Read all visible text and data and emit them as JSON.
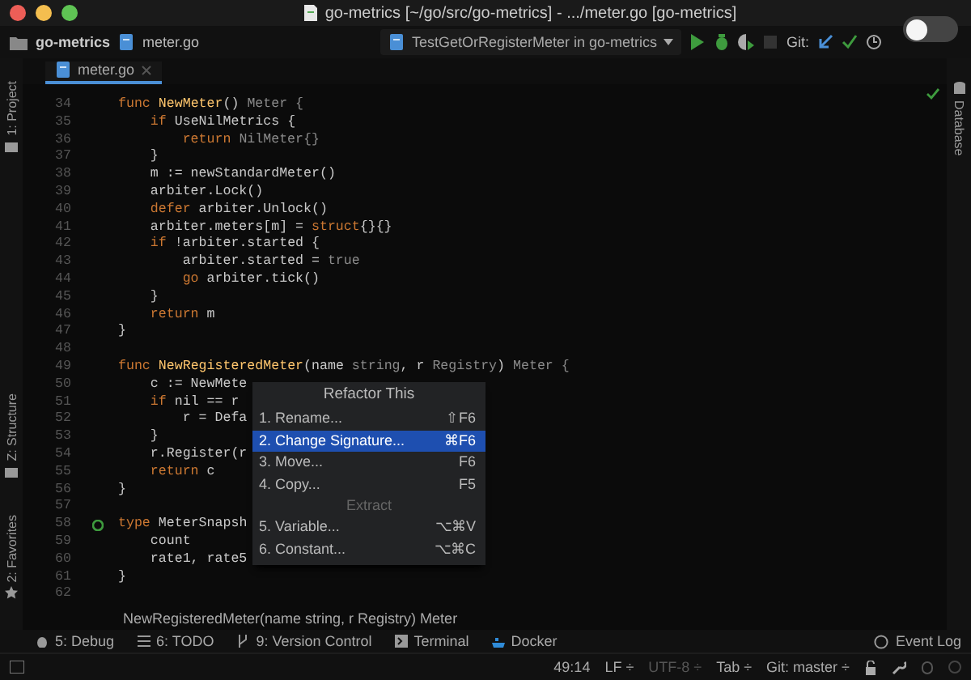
{
  "window": {
    "title": "go-metrics [~/go/src/go-metrics] - .../meter.go [go-metrics]"
  },
  "navbar": {
    "project": "go-metrics",
    "file": "meter.go",
    "run_config": "TestGetOrRegisterMeter in go-metrics",
    "git_label": "Git:"
  },
  "toggle": {
    "on": false
  },
  "tabs": [
    {
      "label": "meter.go",
      "selected": true
    }
  ],
  "left_tools": [
    "1: Project",
    "Z: Structure",
    "2: Favorites"
  ],
  "right_tools": [
    "Database"
  ],
  "editor": {
    "lines": [
      {
        "number": "34",
        "tokens": [
          {
            "text": "func ",
            "kind": "kw"
          },
          {
            "text": "NewMeter",
            "kind": "fn"
          },
          {
            "text": "() ",
            "kind": "txt"
          },
          {
            "text": "Meter {",
            "kind": "dim"
          }
        ]
      },
      {
        "number": "35",
        "tokens": [
          {
            "text": "    if ",
            "kind": "kw"
          },
          {
            "text": "UseNilMetrics {",
            "kind": "txt"
          }
        ]
      },
      {
        "number": "36",
        "tokens": [
          {
            "text": "        return ",
            "kind": "kw"
          },
          {
            "text": "NilMeter{}",
            "kind": "dim"
          }
        ]
      },
      {
        "number": "37",
        "tokens": [
          {
            "text": "    }",
            "kind": "txt"
          }
        ]
      },
      {
        "number": "38",
        "tokens": [
          {
            "text": "    m := newStandardMeter()",
            "kind": "txt"
          }
        ]
      },
      {
        "number": "39",
        "tokens": [
          {
            "text": "    arbiter.Lock()",
            "kind": "txt"
          }
        ]
      },
      {
        "number": "40",
        "tokens": [
          {
            "text": "    defer ",
            "kind": "kw"
          },
          {
            "text": "arbiter.Unlock()",
            "kind": "txt"
          }
        ]
      },
      {
        "number": "41",
        "tokens": [
          {
            "text": "    arbiter.meters[m] = ",
            "kind": "txt"
          },
          {
            "text": "struct",
            "kind": "kw"
          },
          {
            "text": "{}{}",
            "kind": "txt"
          }
        ]
      },
      {
        "number": "42",
        "tokens": [
          {
            "text": "    if ",
            "kind": "kw"
          },
          {
            "text": "!arbiter.started {",
            "kind": "txt"
          }
        ]
      },
      {
        "number": "43",
        "tokens": [
          {
            "text": "        arbiter.started = ",
            "kind": "txt"
          },
          {
            "text": "true",
            "kind": "dim"
          }
        ]
      },
      {
        "number": "44",
        "tokens": [
          {
            "text": "        go ",
            "kind": "kw"
          },
          {
            "text": "arbiter.tick()",
            "kind": "txt"
          }
        ]
      },
      {
        "number": "45",
        "tokens": [
          {
            "text": "    }",
            "kind": "txt"
          }
        ]
      },
      {
        "number": "46",
        "tokens": [
          {
            "text": "    return ",
            "kind": "kw"
          },
          {
            "text": "m",
            "kind": "txt"
          }
        ]
      },
      {
        "number": "47",
        "tokens": [
          {
            "text": "}",
            "kind": "txt"
          }
        ]
      },
      {
        "number": "48"
      },
      {
        "number": "49",
        "tokens": [
          {
            "text": "func ",
            "kind": "kw"
          },
          {
            "text": "NewRegisteredMeter",
            "kind": "fn"
          },
          {
            "text": "(name ",
            "kind": "txt"
          },
          {
            "text": "string",
            "kind": "dim"
          },
          {
            "text": ", r ",
            "kind": "txt"
          },
          {
            "text": "Registry",
            "kind": "dim"
          },
          {
            "text": ") ",
            "kind": "txt"
          },
          {
            "text": "Meter {",
            "kind": "dim"
          }
        ]
      },
      {
        "number": "50",
        "tokens": [
          {
            "text": "    c := NewMete",
            "kind": "txt"
          }
        ]
      },
      {
        "number": "51",
        "tokens": [
          {
            "text": "    if ",
            "kind": "kw"
          },
          {
            "text": "nil == r",
            "kind": "txt"
          }
        ]
      },
      {
        "number": "52",
        "tokens": [
          {
            "text": "        r = Defa",
            "kind": "txt"
          }
        ]
      },
      {
        "number": "53",
        "tokens": [
          {
            "text": "    }",
            "kind": "txt"
          }
        ]
      },
      {
        "number": "54",
        "tokens": [
          {
            "text": "    r.Register(r",
            "kind": "txt"
          }
        ]
      },
      {
        "number": "55",
        "tokens": [
          {
            "text": "    return ",
            "kind": "kw"
          },
          {
            "text": "c",
            "kind": "txt"
          }
        ]
      },
      {
        "number": "56",
        "tokens": [
          {
            "text": "}",
            "kind": "txt"
          }
        ]
      },
      {
        "number": "57"
      },
      {
        "number": "58",
        "implemented": true,
        "tokens": [
          {
            "text": "type ",
            "kind": "kw"
          },
          {
            "text": "MeterSnapsh",
            "kind": "txt"
          }
        ]
      },
      {
        "number": "59",
        "tokens": [
          {
            "text": "    count",
            "kind": "txt"
          }
        ]
      },
      {
        "number": "60",
        "tokens": [
          {
            "text": "    rate1, rate5",
            "kind": "txt"
          }
        ]
      },
      {
        "number": "61",
        "tokens": [
          {
            "text": "}",
            "kind": "txt"
          }
        ]
      },
      {
        "number": "62"
      }
    ],
    "hint": "NewRegisteredMeter(name string, r Registry) Meter"
  },
  "popup": {
    "title": "Refactor This",
    "items": [
      {
        "kind": "item",
        "label": "1. Rename...",
        "shortcut": "⇧F6",
        "selected": false
      },
      {
        "kind": "item",
        "label": "2. Change Signature...",
        "shortcut": "⌘F6",
        "selected": true
      },
      {
        "kind": "item",
        "label": "3. Move...",
        "shortcut": "F6",
        "selected": false
      },
      {
        "kind": "item",
        "label": "4. Copy...",
        "shortcut": "F5",
        "selected": false
      },
      {
        "kind": "header",
        "label": "Extract"
      },
      {
        "kind": "item",
        "label": "5. Variable...",
        "shortcut": "⌥⌘V",
        "selected": false
      },
      {
        "kind": "item",
        "label": "6. Constant...",
        "shortcut": "⌥⌘C",
        "selected": false
      }
    ]
  },
  "tool_buttons": [
    {
      "kind": "debug",
      "label": "5: Debug"
    },
    {
      "kind": "todo",
      "label": "6: TODO"
    },
    {
      "kind": "vcs",
      "label": "9: Version Control"
    },
    {
      "kind": "terminal",
      "label": "Terminal"
    },
    {
      "kind": "docker",
      "label": "Docker"
    }
  ],
  "event_log": "Event Log",
  "status_bar": {
    "position": "49:14",
    "line_sep": "LF ÷",
    "encoding": "UTF-8 ÷",
    "indent": "Tab ÷",
    "branch": "Git: master ÷"
  }
}
